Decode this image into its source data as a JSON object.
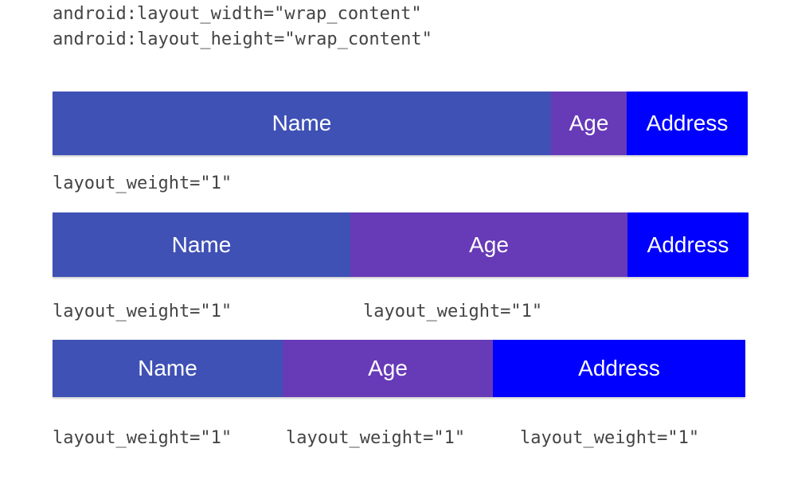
{
  "header": {
    "line1": "android:layout_width=\"wrap_content\"",
    "line2": "android:layout_height=\"wrap_content\""
  },
  "colors": {
    "name": "#3f51b5",
    "age": "#673ab7",
    "address": "#0000ff"
  },
  "rows": [
    {
      "cells": {
        "name": "Name",
        "age": "Age",
        "address": "Address"
      }
    },
    {
      "cells": {
        "name": "Name",
        "age": "Age",
        "address": "Address"
      },
      "caption": "layout_weight=\"1\""
    },
    {
      "cells": {
        "name": "Name",
        "age": "Age",
        "address": "Address"
      },
      "captions": [
        "layout_weight=\"1\"",
        "layout_weight=\"1\""
      ]
    },
    {
      "captions": [
        "layout_weight=\"1\"",
        "layout_weight=\"1\"",
        "layout_weight=\"1\""
      ]
    }
  ]
}
